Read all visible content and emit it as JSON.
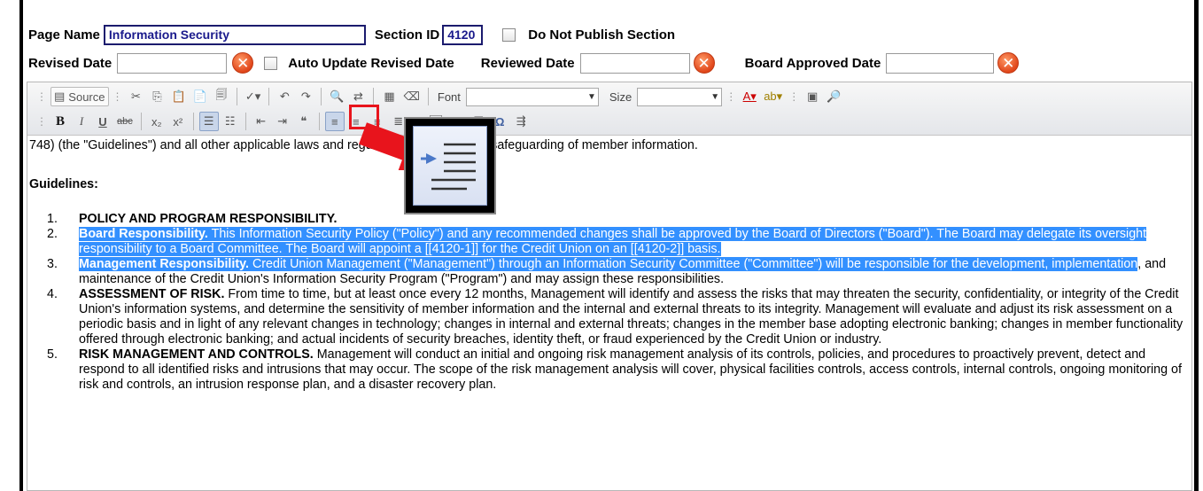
{
  "form": {
    "page_name_label": "Page Name",
    "page_name_value": "Information Security",
    "section_id_label": "Section ID",
    "section_id_value": "4120",
    "do_not_publish_label": "Do Not Publish Section",
    "revised_date_label": "Revised Date",
    "revised_date_value": "",
    "auto_update_label": "Auto Update Revised Date",
    "reviewed_date_label": "Reviewed Date",
    "reviewed_date_value": "",
    "board_approved_label": "Board Approved Date",
    "board_approved_value": "",
    "clear_glyph": "✕"
  },
  "toolbar": {
    "source_label": "Source",
    "font_label": "Font",
    "size_label": "Size",
    "font_value": "",
    "size_value": "",
    "bold": "B",
    "italic": "I",
    "underline": "U",
    "strike": "abc",
    "subscript": "x₂",
    "superscript": "x²",
    "omega": "Ω"
  },
  "content": {
    "line1": "748) (the \"Guidelines\") and all other applicable laws and regulations regarding the safeguarding of member information.",
    "guidelines_heading": "Guidelines:",
    "items": [
      {
        "num": "1.",
        "title": "POLICY AND PROGRAM RESPONSIBILITY.",
        "text": ""
      },
      {
        "num": "2.",
        "title": "Board Responsibility.",
        "text": " This Information Security Policy (\"Policy\") and any recommended changes shall be approved by the Board of Directors (\"Board\"). The Board may delegate its oversight responsibility to a Board Committee. The Board will appoint a [[4120-1]] for the Credit Union on an [[4120-2]] basis."
      },
      {
        "num": "3.",
        "title": "Management Responsibility.",
        "text_hl": " Credit Union Management (\"Management\") through an Information Security Committee (\"Committee\") will be responsible for the development, implementation",
        "text": ", and maintenance of the Credit Union's Information Security Program (\"Program\") and may assign these responsibilities."
      },
      {
        "num": "4.",
        "title": "ASSESSMENT OF RISK.",
        "text": " From time to time, but at least once every 12 months, Management will identify and assess the risks that may threaten the security, confidentiality, or integrity of the Credit Union's information systems, and determine the sensitivity of member information and the internal and external threats to its integrity. Management will evaluate and adjust its risk assessment on a periodic basis and in light of any relevant changes in technology; changes in internal and external threats; changes in the member base adopting electronic banking; changes in member functionality offered through electronic banking; and actual incidents of security breaches, identity theft, or fraud experienced by the Credit Union or industry."
      },
      {
        "num": "5.",
        "title": "RISK MANAGEMENT AND CONTROLS.",
        "text": " Management will conduct an initial and ongoing risk management analysis of its controls, policies, and procedures to proactively prevent, detect and respond to all identified risks and intrusions that may occur. The scope of the risk management analysis will cover, physical facilities controls, access controls, internal controls, ongoing monitoring of risk and controls, an intrusion response plan, and a disaster recovery plan."
      }
    ]
  },
  "colors": {
    "highlight": "#3390ff",
    "clear_button": "#e0461a",
    "arrow": "#e8141c",
    "input_text": "#1a1a8c"
  },
  "icons": [
    "clear-icon",
    "source-icon",
    "cut-icon",
    "copy-icon",
    "paste-icon",
    "spellcheck-icon",
    "undo-icon",
    "redo-icon",
    "find-icon",
    "replace-icon",
    "select-all-icon",
    "remove-format-icon",
    "text-color-icon",
    "bg-color-icon",
    "maximize-icon",
    "preview-icon",
    "numbered-list-icon",
    "bulleted-list-icon",
    "outdent-icon",
    "indent-icon",
    "align-left-icon",
    "align-center-icon",
    "align-right-icon",
    "justify-icon",
    "image-icon",
    "table-icon",
    "horizontal-rule-icon",
    "special-char-icon",
    "page-break-icon"
  ]
}
